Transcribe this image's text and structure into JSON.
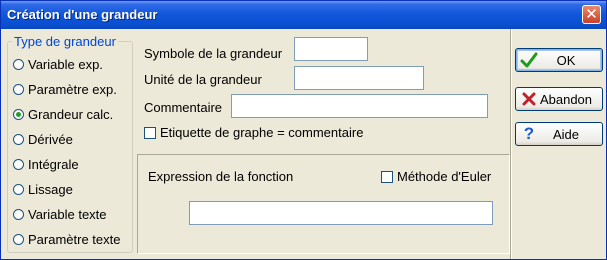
{
  "window": {
    "title": "Création d'une grandeur"
  },
  "grandeur_type": {
    "legend": "Type de grandeur",
    "options": [
      {
        "label": "Variable exp.",
        "checked": false
      },
      {
        "label": "Paramètre exp.",
        "checked": false
      },
      {
        "label": "Grandeur calc.",
        "checked": true
      },
      {
        "label": "Dérivée",
        "checked": false
      },
      {
        "label": "Intégrale",
        "checked": false
      },
      {
        "label": "Lissage",
        "checked": false
      },
      {
        "label": "Variable texte",
        "checked": false
      },
      {
        "label": "Paramètre texte",
        "checked": false
      }
    ]
  },
  "form": {
    "symbole_label": "Symbole de la grandeur",
    "symbole_value": "",
    "unite_label": "Unité de la grandeur",
    "unite_value": "",
    "commentaire_label": "Commentaire",
    "commentaire_value": "",
    "etiquette_label": "Etiquette de graphe = commentaire",
    "etiquette_checked": false
  },
  "expression": {
    "label": "Expression de la fonction",
    "euler_label": "Méthode d'Euler",
    "euler_checked": false,
    "value": ""
  },
  "buttons": {
    "ok": {
      "label": "OK",
      "icon": "check-icon",
      "color": "#1d9b1d"
    },
    "abandon": {
      "label": "Abandon",
      "icon": "cross-icon",
      "color": "#c0202a"
    },
    "aide": {
      "label": "Aide",
      "icon": "question-icon",
      "color": "#1f5bd0"
    }
  }
}
